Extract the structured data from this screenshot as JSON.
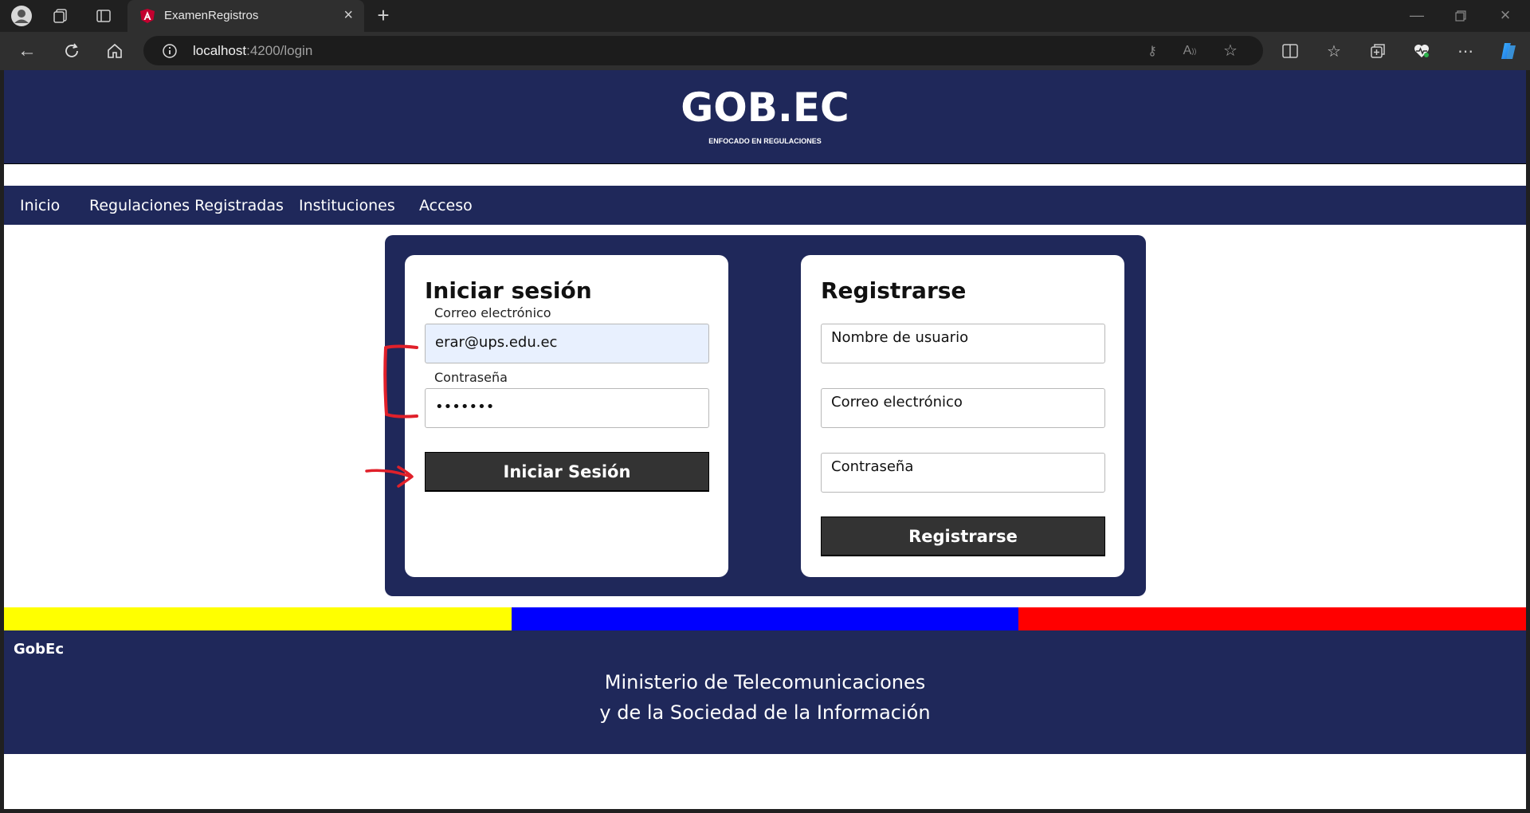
{
  "browser": {
    "tab_title": "ExamenRegistros",
    "url_host": "localhost",
    "url_path": ":4200/login",
    "icons": [
      "profile-icon",
      "collections-icon",
      "tab-actions-icon",
      "angular-favicon",
      "close-icon",
      "new-tab-icon",
      "minimize-icon",
      "restore-icon",
      "window-close-icon",
      "back-icon",
      "refresh-icon",
      "home-icon",
      "info-icon",
      "key-icon",
      "read-aloud-icon",
      "favorite-icon",
      "split-screen-icon",
      "favorites-icon",
      "collections-icon",
      "health-icon",
      "more-icon",
      "copilot-icon"
    ]
  },
  "header": {
    "title": "GOB.EC",
    "subtitle": "ENFOCADO EN REGULACIONES"
  },
  "nav": {
    "items": [
      {
        "label": "Inicio"
      },
      {
        "label": "Regulaciones Registradas"
      },
      {
        "label": "Instituciones"
      },
      {
        "label": "Acceso"
      }
    ]
  },
  "login": {
    "title": "Iniciar sesión",
    "email_label": "Correo electrónico",
    "email_value": "erar@ups.edu.ec",
    "password_label": "Contraseña",
    "password_value": "•••••••",
    "button": "Iniciar Sesión"
  },
  "register": {
    "title": "Registrarse",
    "username_placeholder": "Nombre de usuario",
    "email_placeholder": "Correo electrónico",
    "password_placeholder": "Contraseña",
    "button": "Registrarse"
  },
  "flag_colors": [
    "#ffff00",
    "#0000ff",
    "#ff0000"
  ],
  "footer": {
    "brand": "GobEc",
    "line1": "Ministerio de Telecomunicaciones",
    "line2": "y de la Sociedad de la Información"
  },
  "colors": {
    "brand_navy": "#1f285a",
    "button_dark": "#333333",
    "annotation_red": "#e0202a"
  }
}
